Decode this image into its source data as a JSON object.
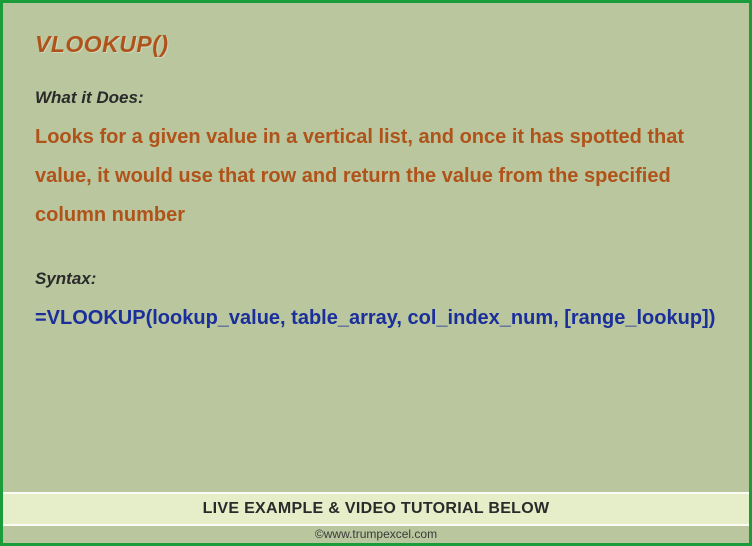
{
  "title": "VLOOKUP()",
  "sections": {
    "what_it_does": {
      "label": "What it Does:",
      "text": "Looks for a given value in a vertical list, and once it has spotted that value, it would use that row and return the value from the specified column number"
    },
    "syntax": {
      "label": "Syntax:",
      "text": "=VLOOKUP(lookup_value, table_array, col_index_num, [range_lookup])"
    }
  },
  "footer": "LIVE EXAMPLE & VIDEO TUTORIAL BELOW",
  "credit": "©www.trumpexcel.com"
}
